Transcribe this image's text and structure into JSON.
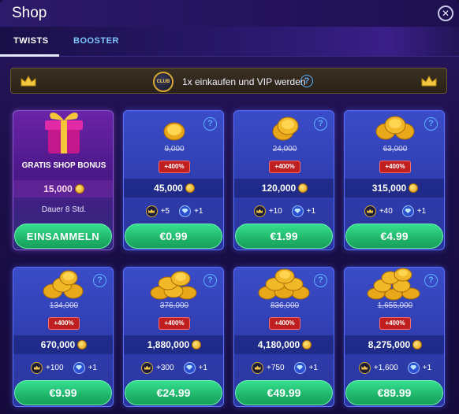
{
  "window": {
    "title": "Shop"
  },
  "tabs": [
    {
      "label": "TWISTS",
      "active": true
    },
    {
      "label": "BOOSTER",
      "active": false
    }
  ],
  "banner": {
    "badge": "CLUB",
    "text": "1x einkaufen und VIP werden"
  },
  "free_offer": {
    "title": "GRATIS SHOP BONUS",
    "amount": "15,000",
    "duration": "Dauer 8 Std.",
    "button": "EINSAMMELN"
  },
  "offers": [
    {
      "old_price": "9,000",
      "bonus_pct": "+400%",
      "amount": "45,000",
      "vip_points": "+5",
      "gems": "+1",
      "price": "€0.99"
    },
    {
      "old_price": "24,000",
      "bonus_pct": "+400%",
      "amount": "120,000",
      "vip_points": "+10",
      "gems": "+1",
      "price": "€1.99"
    },
    {
      "old_price": "63,000",
      "bonus_pct": "+400%",
      "amount": "315,000",
      "vip_points": "+40",
      "gems": "+1",
      "price": "€4.99"
    },
    {
      "old_price": "134,000",
      "bonus_pct": "+400%",
      "amount": "670,000",
      "vip_points": "+100",
      "gems": "+1",
      "price": "€9.99"
    },
    {
      "old_price": "376,000",
      "bonus_pct": "+400%",
      "amount": "1,880,000",
      "vip_points": "+300",
      "gems": "+1",
      "price": "€24.99"
    },
    {
      "old_price": "836,000",
      "bonus_pct": "+400%",
      "amount": "4,180,000",
      "vip_points": "+750",
      "gems": "+1",
      "price": "€49.99"
    },
    {
      "old_price": "1,655,000",
      "bonus_pct": "+400%",
      "amount": "8,275,000",
      "vip_points": "+1,600",
      "gems": "+1",
      "price": "€89.99"
    }
  ],
  "colors": {
    "buy_green": "#1fb56a",
    "card_blue": "#2e3cad",
    "badge_red": "#c01f1f",
    "tab_inactive": "#7fc7ff"
  }
}
